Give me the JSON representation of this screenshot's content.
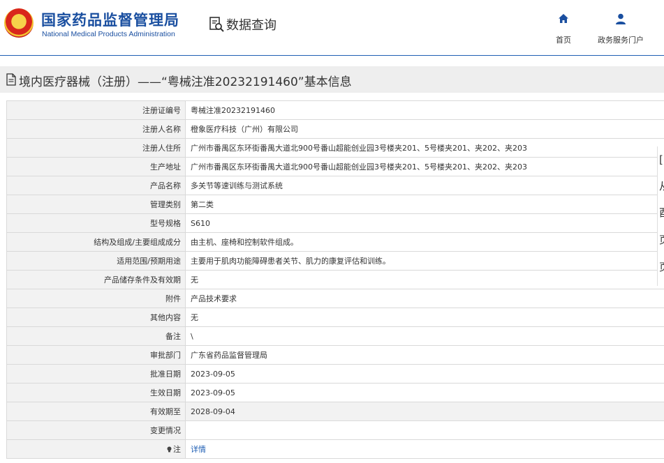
{
  "header": {
    "org_cn": "国家药品监督管理局",
    "org_en": "National Medical Products Administration",
    "db_label": "数据查询",
    "nav": [
      {
        "label": "首页",
        "icon": "home-icon"
      },
      {
        "label": "政务服务门户",
        "icon": "user-icon"
      }
    ]
  },
  "title": "境内医疗器械（注册）——“粤械注准20232191460”基本信息",
  "colors": {
    "brand": "#1a4fa0",
    "link": "#1f5fb4",
    "label_bg": "#f2f2f2"
  },
  "rows": [
    {
      "label": "注册证编号",
      "value": "粤械注准20232191460"
    },
    {
      "label": "注册人名称",
      "value": "橙象医疗科技（广州）有限公司"
    },
    {
      "label": "注册人住所",
      "value": "广州市番禺区东环街番禺大道北900号番山超能创业园3号楼夹201、5号楼夹201、夹202、夹203"
    },
    {
      "label": "生产地址",
      "value": "广州市番禺区东环街番禺大道北900号番山超能创业园3号楼夹201、5号楼夹201、夹202、夹203"
    },
    {
      "label": "产品名称",
      "value": "多关节等速训练与测试系统"
    },
    {
      "label": "管理类别",
      "value": "第二类"
    },
    {
      "label": "型号规格",
      "value": "S610"
    },
    {
      "label": "结构及组成/主要组成成分",
      "value": "由主机、座椅和控制软件组成。"
    },
    {
      "label": "适用范围/预期用途",
      "value": "主要用于肌肉功能障碍患者关节、肌力的康复评估和训练。"
    },
    {
      "label": "产品储存条件及有效期",
      "value": "无"
    },
    {
      "label": "附件",
      "value": "产品技术要求"
    },
    {
      "label": "其他内容",
      "value": "无"
    },
    {
      "label": "备注",
      "value": "\\"
    },
    {
      "label": "审批部门",
      "value": "广东省药品监督管理局"
    },
    {
      "label": "批准日期",
      "value": "2023-09-05"
    },
    {
      "label": "生效日期",
      "value": "2023-09-05"
    },
    {
      "label": "有效期至",
      "value": "2028-09-04"
    },
    {
      "label": "变更情况",
      "value": ""
    }
  ],
  "note_row": {
    "label": "注",
    "value": "详情"
  },
  "side_panel_glyphs": [
    "[",
    "从",
    "酉",
    "页",
    "页"
  ]
}
